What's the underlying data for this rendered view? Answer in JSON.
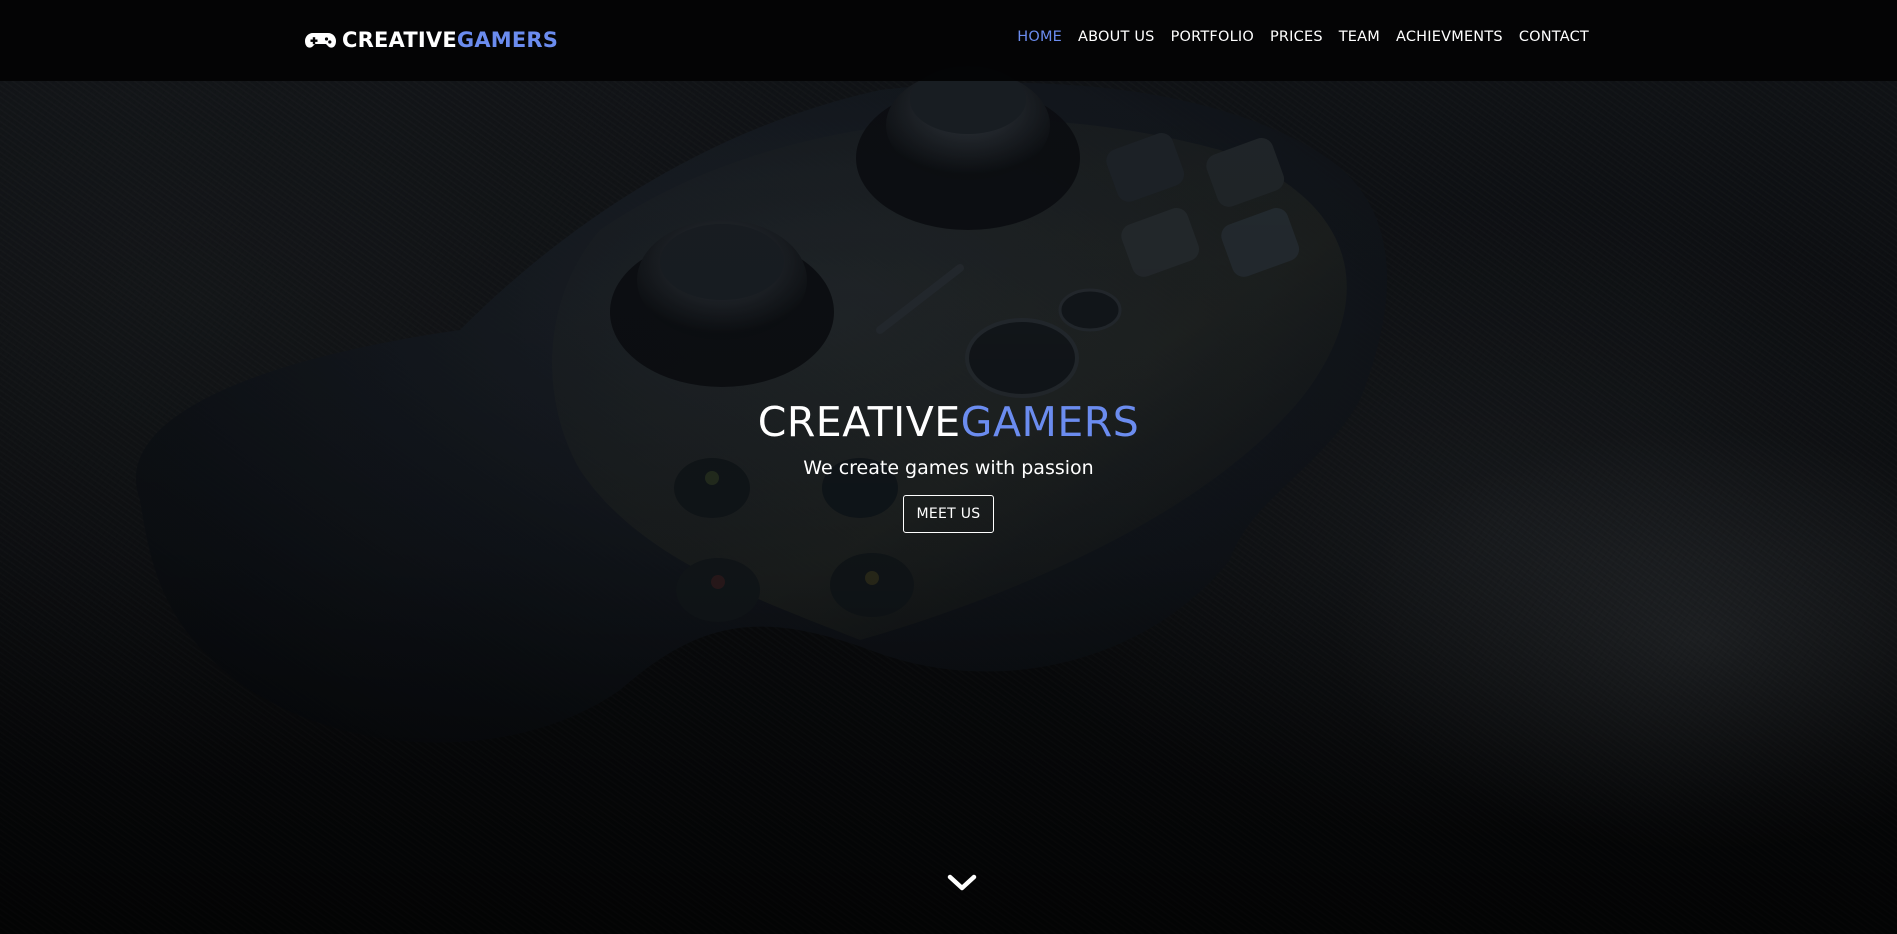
{
  "navbar": {
    "brand": {
      "icon": "gamepad-icon",
      "text_primary": "CREATIVE",
      "text_accent": "GAMERS"
    },
    "menu": [
      {
        "label": "HOME",
        "active": true
      },
      {
        "label": "ABOUT US",
        "active": false
      },
      {
        "label": "PORTFOLIO",
        "active": false
      },
      {
        "label": "PRICES",
        "active": false
      },
      {
        "label": "TEAM",
        "active": false
      },
      {
        "label": "ACHIEVMENTS",
        "active": false
      },
      {
        "label": "CONTACT",
        "active": false
      }
    ]
  },
  "hero": {
    "background": "dark photo of a game controller on textured leather",
    "title_primary": "CREATIVE",
    "title_accent": "GAMERS",
    "subtitle": "We create games with passion",
    "cta_label": "MEET US",
    "scroll_icon": "chevron-down-icon"
  },
  "colors": {
    "accent": "#6b8cef",
    "navbar_bg": "#040405",
    "text": "#ffffff"
  }
}
